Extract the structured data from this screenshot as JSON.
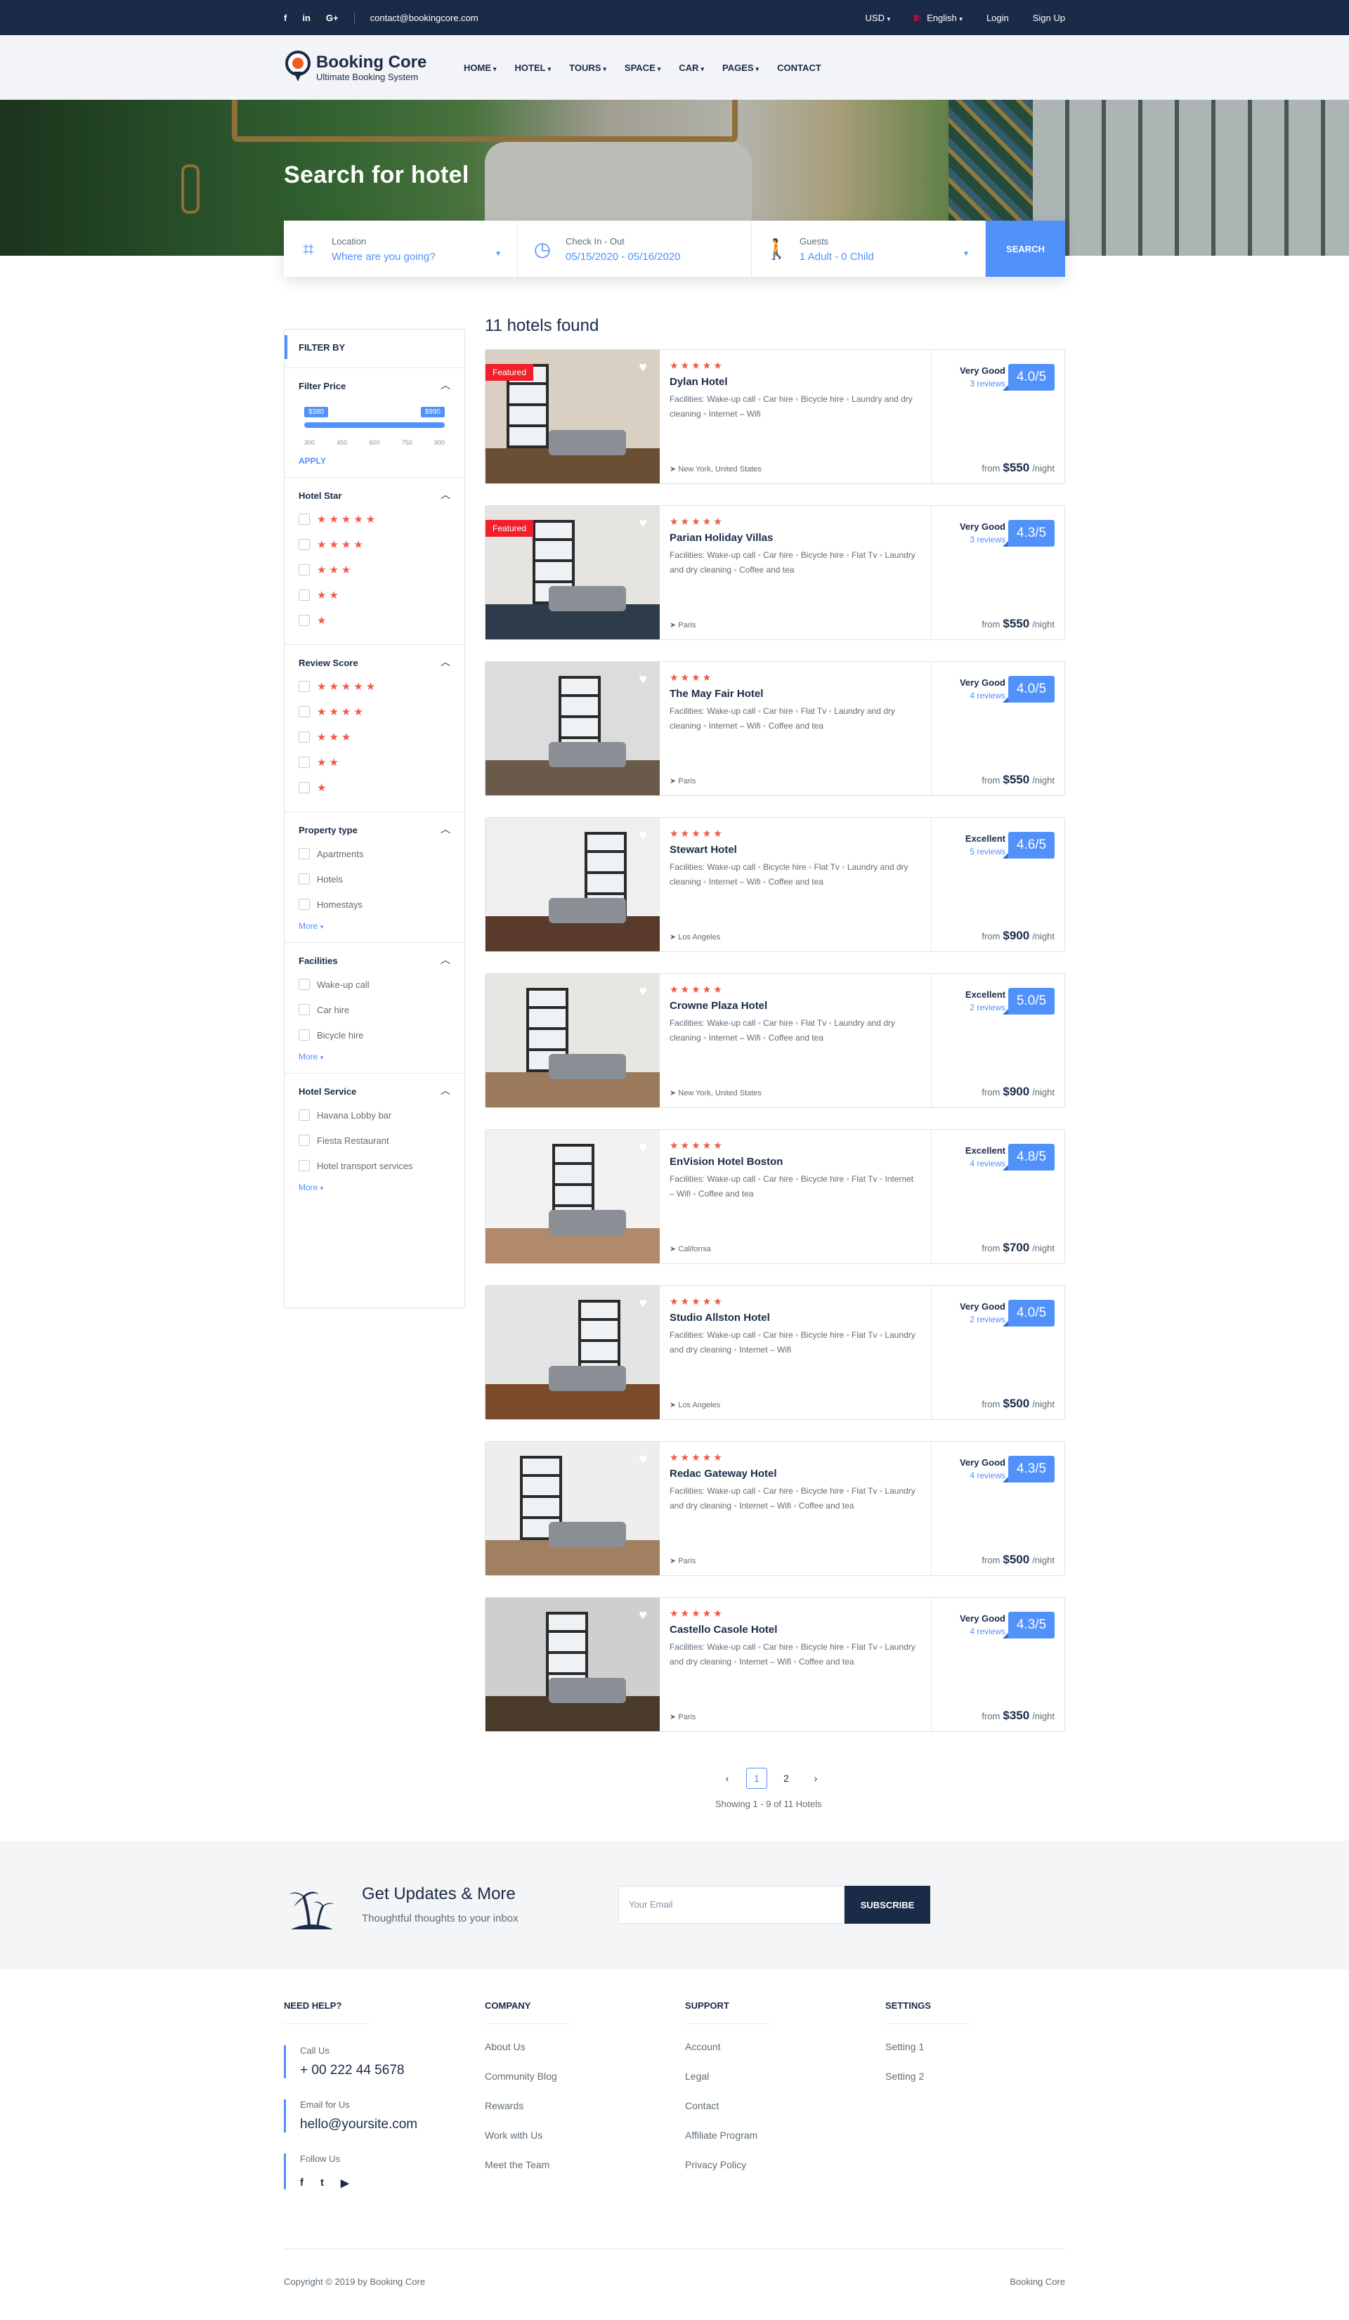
{
  "topbar": {
    "social": [
      "f",
      "in",
      "G+"
    ],
    "email": "contact@bookingcore.com",
    "currency": "USD",
    "language": "English",
    "login": "Login",
    "signup": "Sign Up"
  },
  "header": {
    "logo_title": "Booking Core",
    "logo_subtitle": "Ultimate Booking System",
    "nav": [
      {
        "label": "HOME",
        "has_dropdown": true
      },
      {
        "label": "HOTEL",
        "has_dropdown": true
      },
      {
        "label": "TOURS",
        "has_dropdown": true
      },
      {
        "label": "SPACE",
        "has_dropdown": true
      },
      {
        "label": "CAR",
        "has_dropdown": true
      },
      {
        "label": "PAGES",
        "has_dropdown": true
      },
      {
        "label": "CONTACT",
        "has_dropdown": false
      }
    ]
  },
  "hero": {
    "title": "Search for hotel"
  },
  "search": {
    "location_label": "Location",
    "location_value": "Where are you going?",
    "dates_label": "Check In - Out",
    "dates_value": "05/15/2020 - 05/16/2020",
    "guests_label": "Guests",
    "guests_value": "1 Adult - 0 Child",
    "button": "SEARCH"
  },
  "filters": {
    "title": "FILTER BY",
    "price": {
      "label": "Filter Price",
      "min_tag": "$380",
      "max_tag": "$990",
      "ticks": [
        "300",
        "450",
        "600",
        "750",
        "900"
      ],
      "apply": "APPLY"
    },
    "hotel_star": {
      "label": "Hotel Star",
      "options": [
        "★★★★★",
        "★★★★",
        "★★★",
        "★★",
        "★"
      ]
    },
    "review_score": {
      "label": "Review Score",
      "options": [
        "★★★★★",
        "★★★★",
        "★★★",
        "★★",
        "★"
      ]
    },
    "property_type": {
      "label": "Property type",
      "options": [
        "Apartments",
        "Hotels",
        "Homestays"
      ],
      "more": "More"
    },
    "facilities": {
      "label": "Facilities",
      "options": [
        "Wake-up call",
        "Car hire",
        "Bicycle hire"
      ],
      "more": "More"
    },
    "hotel_service": {
      "label": "Hotel Service",
      "options": [
        "Havana Lobby bar",
        "Fiesta Restaurant",
        "Hotel transport services"
      ],
      "more": "More"
    }
  },
  "results": {
    "title": "11 hotels found",
    "hotels": [
      {
        "name": "Dylan Hotel",
        "stars": "★★★★★",
        "featured": "Featured",
        "facilities": "Facilities:  Wake-up call  ◦ Car hire  ◦ Bicycle hire  ◦ Laundry and dry cleaning  ◦ Internet – Wifi",
        "location": "New York, United States",
        "rating_text": "Very Good",
        "reviews": "3 reviews",
        "score": "4.0/5",
        "from": "from",
        "price": "$550",
        "unit": "/night"
      },
      {
        "name": "Parian Holiday Villas",
        "stars": "★★★★★",
        "featured": "Featured",
        "facilities": "Facilities:  Wake-up call  ◦ Car hire  ◦ Bicycle hire  ◦ Flat Tv  ◦ Laundry and dry cleaning  ◦ Coffee and tea",
        "location": "Paris",
        "rating_text": "Very Good",
        "reviews": "3 reviews",
        "score": "4.3/5",
        "from": "from",
        "price": "$550",
        "unit": "/night"
      },
      {
        "name": "The May Fair Hotel",
        "stars": "★★★★",
        "featured": "",
        "facilities": "Facilities:  Wake-up call  ◦ Car hire  ◦ Flat Tv  ◦ Laundry and dry cleaning  ◦ Internet – Wifi  ◦ Coffee and tea",
        "location": "Paris",
        "rating_text": "Very Good",
        "reviews": "4 reviews",
        "score": "4.0/5",
        "from": "from",
        "price": "$550",
        "unit": "/night"
      },
      {
        "name": "Stewart Hotel",
        "stars": "★★★★★",
        "featured": "",
        "facilities": "Facilities:  Wake-up call  ◦ Bicycle hire  ◦ Flat Tv  ◦ Laundry and dry cleaning  ◦ Internet – Wifi  ◦ Coffee and tea",
        "location": "Los Angeles",
        "rating_text": "Excellent",
        "reviews": "5 reviews",
        "score": "4.6/5",
        "from": "from",
        "price": "$900",
        "unit": "/night"
      },
      {
        "name": "Crowne Plaza Hotel",
        "stars": "★★★★★",
        "featured": "",
        "facilities": "Facilities:  Wake-up call  ◦ Car hire  ◦ Flat Tv  ◦ Laundry and dry cleaning  ◦ Internet – Wifi  ◦ Coffee and tea",
        "location": "New York, United States",
        "rating_text": "Excellent",
        "reviews": "2 reviews",
        "score": "5.0/5",
        "from": "from",
        "price": "$900",
        "unit": "/night"
      },
      {
        "name": "EnVision Hotel Boston",
        "stars": "★★★★★",
        "featured": "",
        "facilities": "Facilities:  Wake-up call  ◦ Car hire  ◦ Bicycle hire  ◦ Flat Tv  ◦ Internet – Wifi  ◦ Coffee and tea",
        "location": "California",
        "rating_text": "Excellent",
        "reviews": "4 reviews",
        "score": "4.8/5",
        "from": "from",
        "price": "$700",
        "unit": "/night"
      },
      {
        "name": "Studio Allston Hotel",
        "stars": "★★★★★",
        "featured": "",
        "facilities": "Facilities:  Wake-up call  ◦ Car hire  ◦ Bicycle hire  ◦ Flat Tv  ◦ Laundry and dry cleaning  ◦ Internet – Wifi",
        "location": "Los Angeles",
        "rating_text": "Very Good",
        "reviews": "2 reviews",
        "score": "4.0/5",
        "from": "from",
        "price": "$500",
        "unit": "/night"
      },
      {
        "name": "Redac Gateway Hotel",
        "stars": "★★★★★",
        "featured": "",
        "facilities": "Facilities:  Wake-up call  ◦ Car hire  ◦ Bicycle hire  ◦ Flat Tv  ◦ Laundry and dry cleaning  ◦ Internet – Wifi  ◦ Coffee and tea",
        "location": "Paris",
        "rating_text": "Very Good",
        "reviews": "4 reviews",
        "score": "4.3/5",
        "from": "from",
        "price": "$500",
        "unit": "/night"
      },
      {
        "name": "Castello Casole Hotel",
        "stars": "★★★★★",
        "featured": "",
        "facilities": "Facilities:  Wake-up call  ◦ Car hire  ◦ Bicycle hire  ◦ Flat Tv  ◦ Laundry and dry cleaning  ◦ Internet – Wifi  ◦ Coffee and tea",
        "location": "Paris",
        "rating_text": "Very Good",
        "reviews": "4 reviews",
        "score": "4.3/5",
        "from": "from",
        "price": "$350",
        "unit": "/night"
      }
    ]
  },
  "pagination": {
    "prev": "‹",
    "pages": [
      "1",
      "2"
    ],
    "current": "1",
    "next": "›",
    "info": "Showing 1 - 9 of 11 Hotels"
  },
  "newsletter": {
    "title": "Get Updates & More",
    "subtitle": "Thoughtful thoughts to your inbox",
    "placeholder": "Your Email",
    "button": "SUBSCRIBE"
  },
  "footer": {
    "help": {
      "title": "NEED HELP?",
      "call_label": "Call Us",
      "call_value": "+ 00 222 44 5678",
      "email_label": "Email for Us",
      "email_value": "hello@yoursite.com",
      "follow_label": "Follow Us",
      "social": [
        "f",
        "t",
        "▶"
      ]
    },
    "company": {
      "title": "COMPANY",
      "links": [
        "About Us",
        "Community Blog",
        "Rewards",
        "Work with Us",
        "Meet the Team"
      ]
    },
    "support": {
      "title": "SUPPORT",
      "links": [
        "Account",
        "Legal",
        "Contact",
        "Affiliate Program",
        "Privacy Policy"
      ]
    },
    "settings": {
      "title": "SETTINGS",
      "links": [
        "Setting 1",
        "Setting 2"
      ]
    },
    "copyright": "Copyright © 2019 by Booking Core",
    "brand": "Booking Core"
  },
  "colors": {
    "primary": "#5191fa",
    "dark": "#1a2b48",
    "star": "#f05845",
    "featured": "#f1202b"
  }
}
